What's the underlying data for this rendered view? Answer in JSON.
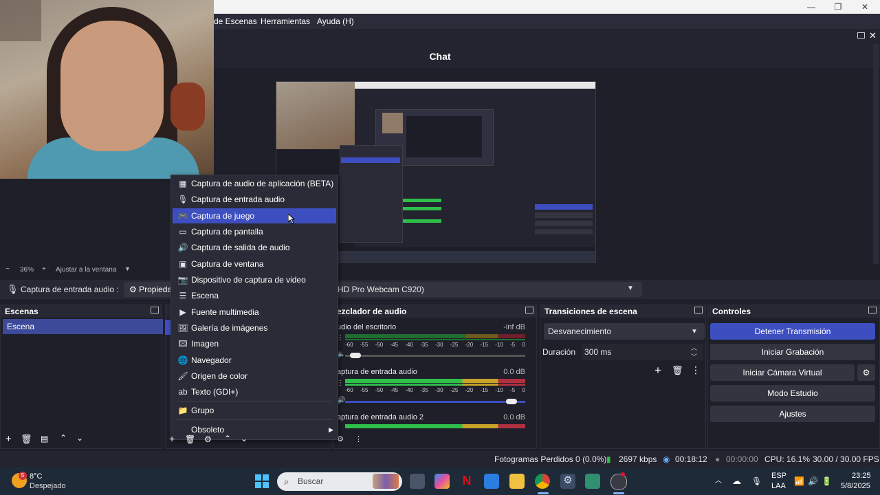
{
  "window": {
    "minimize": "—",
    "restore": "❐",
    "close": "✕"
  },
  "menu": {
    "items": [
      "de Escenas",
      "Herramientas",
      "Ayuda (H)"
    ]
  },
  "chat": {
    "title": "Chat"
  },
  "zoom": {
    "minus": "−",
    "value": "36%",
    "plus": "+",
    "fit": "Ajustar a la ventana"
  },
  "source_bar": {
    "name": "Captura de entrada audio :",
    "properties": "Propieda",
    "device": "HD Pro Webcam C920)"
  },
  "scenes": {
    "title": "Escenas",
    "items": [
      "Escena"
    ]
  },
  "context_menu": {
    "items": [
      {
        "icon": "▦",
        "label": "Captura de audio de aplicación (BETA)"
      },
      {
        "icon": "🎙",
        "label": "Captura de entrada audio"
      },
      {
        "icon": "🎮",
        "label": "Captura de juego"
      },
      {
        "icon": "▭",
        "label": "Captura de pantalla"
      },
      {
        "icon": "🔊",
        "label": "Captura de salida de audio"
      },
      {
        "icon": "▣",
        "label": "Captura de ventana"
      },
      {
        "icon": "📷",
        "label": "Dispositivo de captura de video"
      },
      {
        "icon": "☰",
        "label": "Escena"
      },
      {
        "icon": "▶",
        "label": "Fuente multimedia"
      },
      {
        "icon": "🖼",
        "label": "Galería de imágenes"
      },
      {
        "icon": "🖾",
        "label": "Imagen"
      },
      {
        "icon": "🌐",
        "label": "Navegador"
      },
      {
        "icon": "🖌",
        "label": "Origen de color"
      },
      {
        "icon": "ab",
        "label": "Texto (GDI+)"
      },
      {
        "icon": "📁",
        "label": "Grupo"
      },
      {
        "icon": "",
        "label": "Obsoleto"
      }
    ],
    "submenu_arrow": "▶"
  },
  "mixer": {
    "title": "ezclador de audio",
    "scale": [
      "-60",
      "-55",
      "-50",
      "-45",
      "-40",
      "-35",
      "-30",
      "-25",
      "-20",
      "-15",
      "-10",
      "-5",
      "0"
    ],
    "channels": [
      {
        "name": "udio del escritorio",
        "level": "-inf dB",
        "volume": 0.03
      },
      {
        "name": "aptura de entrada audio",
        "level": "0.0 dB",
        "volume": 0.95
      },
      {
        "name": "aptura de entrada audio 2",
        "level": "0.0 dB"
      }
    ]
  },
  "transitions": {
    "title": "Transiciones de escena",
    "selected": "Desvanecimiento",
    "duration_label": "Duración",
    "duration_value": "300 ms"
  },
  "controls": {
    "title": "Controles",
    "stop_stream": "Detener Transmisión",
    "start_recording": "Iniciar Grabación",
    "start_vcam": "Iniciar Cámara Virtual",
    "studio_mode": "Modo Estudio",
    "settings": "Ajustes"
  },
  "status": {
    "dropped": "Fotogramas Perdidos 0 (0.0%)",
    "bitrate": "2697 kbps",
    "stream_time": "00:18:12",
    "rec_time": "00:00:00",
    "cpu": "CPU: 16.1%",
    "fps": "30.00 / 30.00 FPS"
  },
  "taskbar": {
    "temp": "8°C",
    "weather": "Despejado",
    "weather_badge": "5",
    "search": "Buscar",
    "lang1": "ESP",
    "lang2": "LAA",
    "time": "23:25",
    "date": "5/8/2025"
  },
  "colors": {
    "accent": "#3d4fc0",
    "meter_green": "#2fbf4a",
    "meter_yellow": "#c9a227",
    "meter_red": "#b03040"
  }
}
